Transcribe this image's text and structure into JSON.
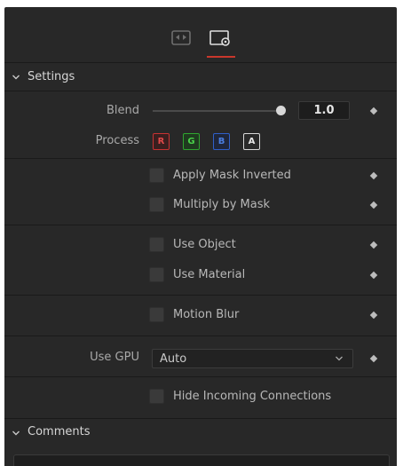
{
  "tabs": [
    {
      "icon": "transform-icon",
      "active": false
    },
    {
      "icon": "settings-tab-icon",
      "active": true
    }
  ],
  "settings": {
    "header": "Settings",
    "blend_label": "Blend",
    "blend_value": "1.0",
    "blend_fraction": 1.0,
    "process_label": "Process",
    "channels": [
      "R",
      "G",
      "B",
      "A"
    ],
    "apply_mask_inverted": "Apply Mask Inverted",
    "multiply_by_mask": "Multiply by Mask",
    "use_object": "Use Object",
    "use_material": "Use Material",
    "motion_blur": "Motion Blur",
    "use_gpu_label": "Use GPU",
    "use_gpu_value": "Auto",
    "hide_incoming": "Hide Incoming Connections"
  },
  "comments": {
    "header": "Comments",
    "value": ""
  },
  "colors": {
    "panel_bg": "#282828",
    "accent": "#c9372c",
    "channel_r": "#c83232",
    "channel_g": "#2fa52f",
    "channel_b": "#2f5fc8",
    "channel_a": "#d8d8d8"
  }
}
